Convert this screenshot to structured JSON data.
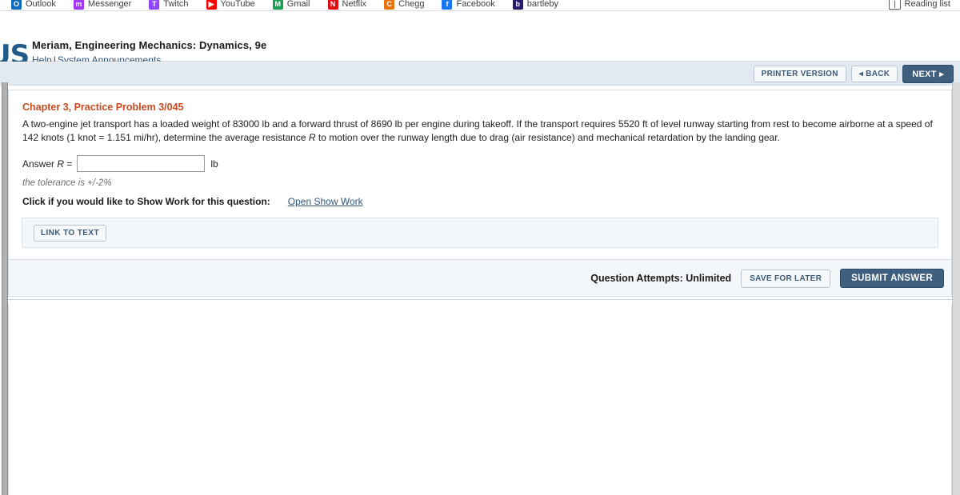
{
  "browser": {
    "bookmarks": [
      {
        "label": "Outlook",
        "icon": "outlook-icon",
        "color": "#0f6cbd",
        "glyph": "O"
      },
      {
        "label": "Messenger",
        "icon": "messenger-icon",
        "color": "#a334fa",
        "glyph": "m"
      },
      {
        "label": "Twitch",
        "icon": "twitch-icon",
        "color": "#9146ff",
        "glyph": "T"
      },
      {
        "label": "YouTube",
        "icon": "youtube-icon",
        "color": "#ff0000",
        "glyph": "▶"
      },
      {
        "label": "Gmail",
        "icon": "gmail-icon",
        "color": "#1a9c54",
        "glyph": "M"
      },
      {
        "label": "Netflix",
        "icon": "netflix-icon",
        "color": "#e50914",
        "glyph": "N"
      },
      {
        "label": "Chegg",
        "icon": "chegg-icon",
        "color": "#e8740c",
        "glyph": "C"
      },
      {
        "label": "Facebook",
        "icon": "facebook-icon",
        "color": "#1877f2",
        "glyph": "f"
      },
      {
        "label": "bartleby",
        "icon": "bartleby-icon",
        "color": "#2a1a6e",
        "glyph": "b"
      }
    ],
    "reading_list_label": "Reading list"
  },
  "header": {
    "logo_text": "US",
    "title": "Meriam, Engineering Mechanics: Dynamics, 9e",
    "help_label": "Help",
    "separator": "|",
    "announcements_label": "System Announcements"
  },
  "toolbar": {
    "printer_label": "PRINTER VERSION",
    "back_label": "◂ BACK",
    "next_label": "NEXT ▸"
  },
  "question": {
    "title": "Chapter 3, Practice Problem 3/045",
    "body_part1": "A two-engine jet transport has a loaded weight of 83000 lb and a forward thrust of 8690 lb per engine during takeoff. If the transport requires 5520 ft of level runway starting from rest to become airborne at a speed of 142 knots (1 knot = 1.151 mi/hr), determine the average resistance ",
    "body_var": "R",
    "body_part2": " to motion over the runway length due to drag (air resistance) and mechanical retardation by the landing gear.",
    "answer_label_pre": "Answer ",
    "answer_label_var": "R",
    "answer_label_post": " =",
    "answer_value": "",
    "answer_placeholder": "",
    "answer_unit": "lb",
    "tolerance": "the tolerance is +/-2%",
    "showwork_prompt": "Click if you would like to Show Work for this question:",
    "showwork_link": "Open Show Work",
    "link_to_text_label": "LINK TO TEXT"
  },
  "footer": {
    "attempts": "Question Attempts: Unlimited",
    "save_label": "SAVE FOR LATER",
    "submit_label": "SUBMIT ANSWER"
  },
  "colors": {
    "accent_orange": "#c64b21",
    "link_blue": "#30567d",
    "button_dark": "#3f5f7e",
    "toolbar_band": "#e3e9f1",
    "panel_bg": "#f4f7fa"
  }
}
